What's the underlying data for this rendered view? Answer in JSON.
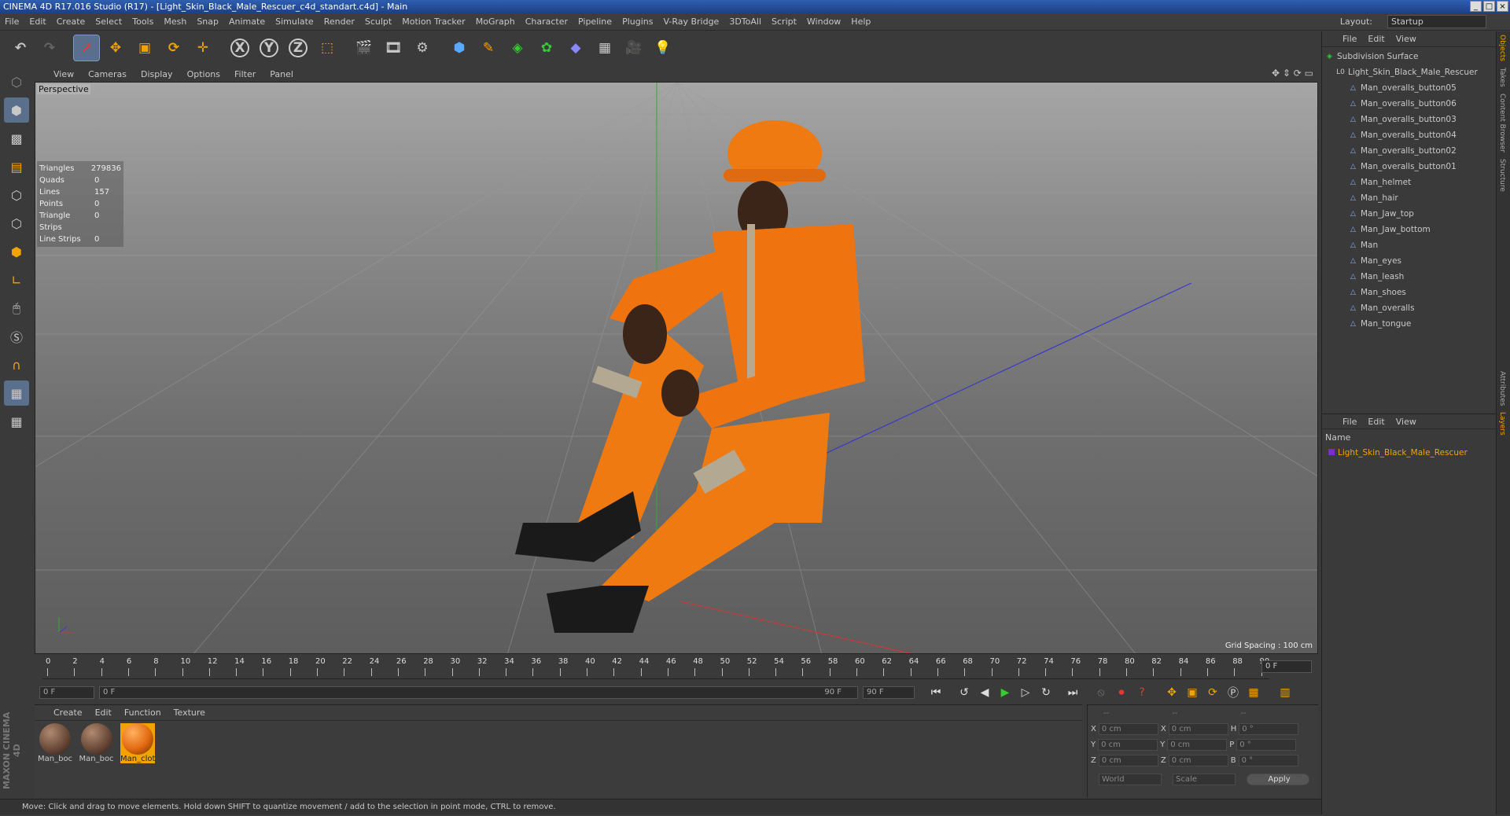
{
  "window": {
    "title": "CINEMA 4D R17.016 Studio (R17) - [Light_Skin_Black_Male_Rescuer_c4d_standart.c4d] - Main"
  },
  "menu": [
    "File",
    "Edit",
    "Create",
    "Select",
    "Tools",
    "Mesh",
    "Snap",
    "Animate",
    "Simulate",
    "Render",
    "Sculpt",
    "Motion Tracker",
    "MoGraph",
    "Character",
    "Pipeline",
    "Plugins",
    "V-Ray Bridge",
    "3DToAll",
    "Script",
    "Window",
    "Help"
  ],
  "layout": {
    "label": "Layout:",
    "value": "Startup"
  },
  "viewport": {
    "menu": [
      "View",
      "Cameras",
      "Display",
      "Options",
      "Filter",
      "Panel"
    ],
    "label": "Perspective",
    "stats": [
      {
        "k": "Triangles",
        "v": "279836"
      },
      {
        "k": "Quads",
        "v": "0"
      },
      {
        "k": "Lines",
        "v": "157"
      },
      {
        "k": "Points",
        "v": "0"
      },
      {
        "k": "Triangle Strips",
        "v": "0"
      },
      {
        "k": "Line Strips",
        "v": "0"
      }
    ],
    "grid_spacing": "Grid Spacing : 100 cm"
  },
  "timeline": {
    "ticks": [
      "0",
      "2",
      "4",
      "6",
      "8",
      "10",
      "12",
      "14",
      "16",
      "18",
      "20",
      "22",
      "24",
      "26",
      "28",
      "30",
      "32",
      "34",
      "36",
      "38",
      "40",
      "42",
      "44",
      "46",
      "48",
      "50",
      "52",
      "54",
      "56",
      "58",
      "60",
      "62",
      "64",
      "66",
      "68",
      "70",
      "72",
      "74",
      "76",
      "78",
      "80",
      "82",
      "84",
      "86",
      "88",
      "90"
    ],
    "current": "0 F",
    "start": "0 F",
    "range_start": "0 F",
    "range_end": "90 F",
    "end": "90 F"
  },
  "materials": {
    "menu": [
      "Create",
      "Edit",
      "Function",
      "Texture"
    ],
    "items": [
      {
        "name": "Man_boc",
        "color": "#6b4a3a"
      },
      {
        "name": "Man_boc",
        "color": "#6b4a3a"
      },
      {
        "name": "Man_clot",
        "color": "#e26a10"
      }
    ]
  },
  "coords": {
    "rows": [
      {
        "a": "X",
        "av": "0 cm",
        "b": "X",
        "bv": "0 cm",
        "c": "H",
        "cv": "0 °"
      },
      {
        "a": "Y",
        "av": "0 cm",
        "b": "Y",
        "bv": "0 cm",
        "c": "P",
        "cv": "0 °"
      },
      {
        "a": "Z",
        "av": "0 cm",
        "b": "Z",
        "bv": "0 cm",
        "c": "B",
        "cv": "0 °"
      }
    ],
    "world": "World",
    "scale": "Scale",
    "apply": "Apply",
    "header": [
      "--",
      "--",
      "--"
    ]
  },
  "status": "Move: Click and drag to move elements. Hold down SHIFT to quantize movement / add to the selection in point mode, CTRL to remove.",
  "objects": {
    "menu": [
      "File",
      "Edit",
      "View"
    ],
    "root": "Subdivision Surface",
    "group": "Light_Skin_Black_Male_Rescuer",
    "items": [
      "Man_overalls_button05",
      "Man_overalls_button06",
      "Man_overalls_button03",
      "Man_overalls_button04",
      "Man_overalls_button02",
      "Man_overalls_button01",
      "Man_helmet",
      "Man_hair",
      "Man_Jaw_top",
      "Man_Jaw_bottom",
      "Man",
      "Man_eyes",
      "Man_leash",
      "Man_shoes",
      "Man_overalls",
      "Man_tongue"
    ]
  },
  "layers": {
    "menu": [
      "File",
      "Edit",
      "View"
    ],
    "col": "Name",
    "item": "Light_Skin_Black_Male_Rescuer"
  },
  "side_tabs": [
    "Objects",
    "Takes",
    "Content Browser",
    "Structure"
  ],
  "side_tabs2": [
    "Attributes",
    "Layers"
  ],
  "logo": "MAXON CINEMA 4D",
  "accent": "#f0a400"
}
